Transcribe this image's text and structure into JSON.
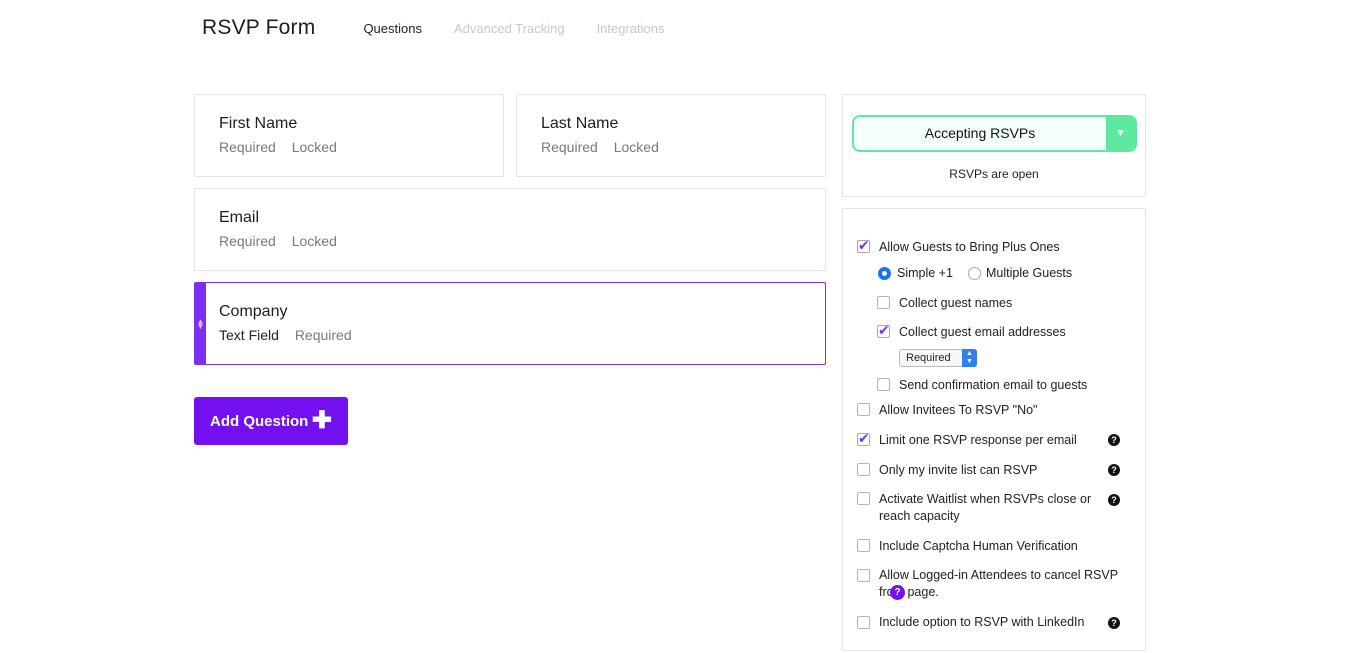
{
  "header": {
    "title": "RSVP Form",
    "tabs": [
      {
        "label": "Questions",
        "active": true
      },
      {
        "label": "Advanced Tracking",
        "active": false
      },
      {
        "label": "Integrations",
        "active": false
      }
    ]
  },
  "questions": [
    {
      "title": "First Name",
      "tags": [
        "Required",
        "Locked"
      ]
    },
    {
      "title": "Last Name",
      "tags": [
        "Required",
        "Locked"
      ]
    },
    {
      "title": "Email",
      "tags": [
        "Required",
        "Locked"
      ]
    },
    {
      "title": "Company",
      "type": "Text Field",
      "tags": [
        "Required"
      ]
    }
  ],
  "add_question_label": "Add Question",
  "status": {
    "selected": "Accepting RSVPs",
    "text": "RSVPs are open",
    "accent": "#5fe8a0"
  },
  "options": {
    "plus_ones": "Allow Guests to Bring Plus Ones",
    "simple": "Simple +1",
    "multiple": "Multiple Guests",
    "collect_names": "Collect guest names",
    "collect_emails": "Collect guest email addresses",
    "required_select": "Required",
    "send_confirmation": "Send confirmation email to guests",
    "allow_no": "Allow Invitees To RSVP \"No\"",
    "limit_one": "Limit one RSVP response per email",
    "invite_only": "Only my invite list can RSVP",
    "waitlist": "Activate Waitlist when RSVPs close or reach capacity",
    "captcha": "Include Captcha Human Verification",
    "cancel": "Allow Logged-in Attendees to cancel RSVP from page.",
    "linkedin": "Include option to RSVP with LinkedIn",
    "help_glyph": "?"
  },
  "brand_color": "#7210f0"
}
